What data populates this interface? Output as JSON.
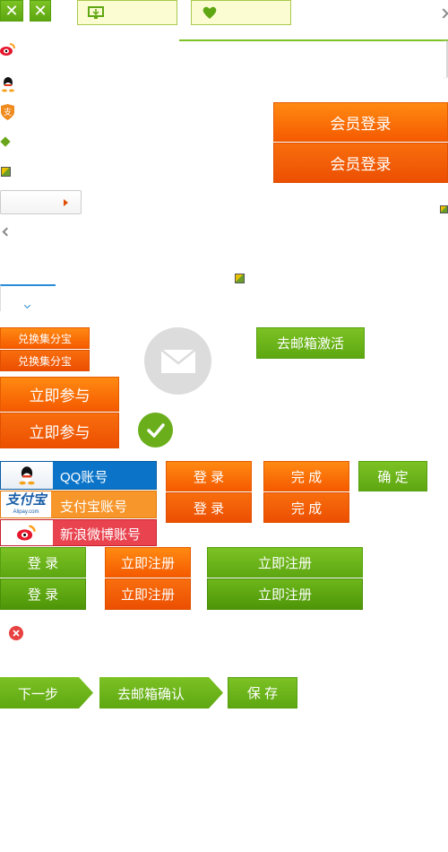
{
  "top": {
    "close_glyph": "✕"
  },
  "member_login": {
    "label_1": "会员登录",
    "label_2": "会员登录"
  },
  "exchange": {
    "label_1": "兑换集分宝",
    "label_2": "兑换集分宝"
  },
  "join": {
    "label_1": "立即参与",
    "label_2": "立即参与"
  },
  "activate": {
    "label": "去邮箱激活"
  },
  "accounts": {
    "qq": "QQ账号",
    "alipay": "支付宝账号",
    "weibo": "新浪微博账号",
    "alipay_logo": "支付宝",
    "alipay_sub": "Alipay.com"
  },
  "login": {
    "label_1": "登 录",
    "label_2": "登 录"
  },
  "done": {
    "label_1": "完 成",
    "label_2": "完 成"
  },
  "confirm": {
    "label": "确 定"
  },
  "green_login": {
    "label_1": "登 录",
    "label_2": "登 录"
  },
  "register_orange": {
    "label_1": "立即注册",
    "label_2": "立即注册"
  },
  "register_green": {
    "label_1": "立即注册",
    "label_2": "立即注册"
  },
  "steps": {
    "next": "下一步",
    "email_confirm": "去邮箱确认",
    "save": "保 存"
  },
  "colors": {
    "orange": "#f66a05",
    "green": "#66ad16",
    "blue": "#0b74c8",
    "red": "#e84141"
  }
}
